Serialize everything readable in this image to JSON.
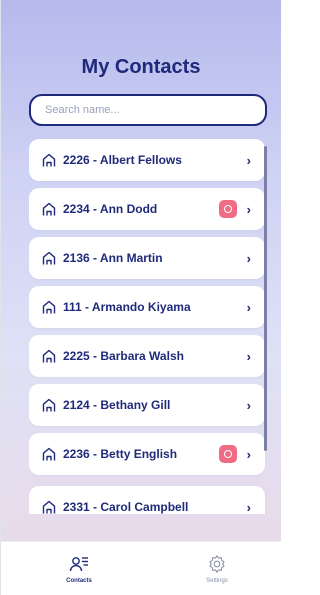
{
  "header": {
    "title": "My Contacts"
  },
  "search": {
    "placeholder": "Search name..."
  },
  "contacts": [
    {
      "label": "2226 - Albert Fellows",
      "badge": false
    },
    {
      "label": "2234 - Ann Dodd",
      "badge": true
    },
    {
      "label": "2136 - Ann Martin",
      "badge": false
    },
    {
      "label": "111 - Armando Kiyama",
      "badge": false
    },
    {
      "label": "2225 - Barbara Walsh",
      "badge": false
    },
    {
      "label": "2124 - Bethany Gill",
      "badge": false
    },
    {
      "label": "2236 - Betty English",
      "badge": true
    },
    {
      "label": "2331 - Carol Campbell",
      "badge": false
    }
  ],
  "tabs": {
    "contacts": "Contacts",
    "settings": "Settings"
  },
  "colors": {
    "accent": "#1f2a7a",
    "badge": "#f06b84"
  }
}
